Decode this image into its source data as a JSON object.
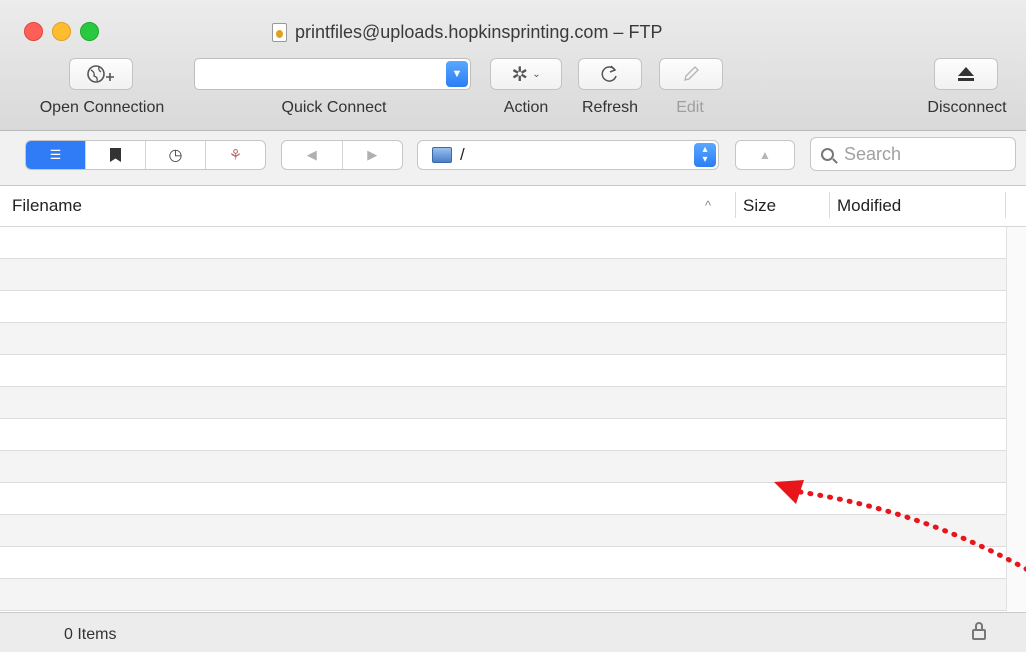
{
  "window": {
    "title": "printfiles@uploads.hopkinsprinting.com – FTP"
  },
  "toolbar": {
    "open_connection": "Open Connection",
    "quick_connect": "Quick Connect",
    "quick_connect_value": "",
    "action": "Action",
    "refresh": "Refresh",
    "edit": "Edit",
    "disconnect": "Disconnect"
  },
  "browser_bar": {
    "path": "/",
    "search_placeholder": "Search"
  },
  "table": {
    "columns": [
      "Filename",
      "Size",
      "Modified"
    ],
    "sorted_column": "Filename",
    "rows": []
  },
  "status": {
    "items": "0 Items"
  },
  "colors": {
    "accent": "#2f7cf6",
    "annotation_arrow": "#e8151b"
  }
}
